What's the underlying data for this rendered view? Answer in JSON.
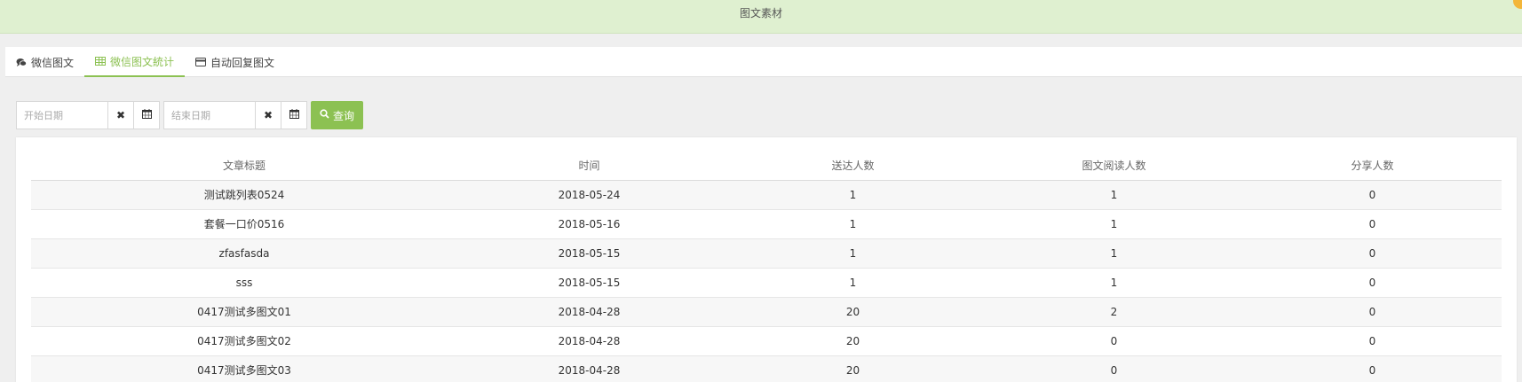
{
  "header": {
    "title": "图文素材"
  },
  "tabs": [
    {
      "label": "微信图文",
      "icon": "comments-icon",
      "active": false
    },
    {
      "label": "微信图文統计",
      "icon": "table-icon",
      "active": true
    },
    {
      "label": "自动回复图文",
      "icon": "card-icon",
      "active": false
    }
  ],
  "filter": {
    "start_placeholder": "开始日期",
    "end_placeholder": "结束日期",
    "clear_glyph": "✖",
    "calendar_glyph": "▦",
    "query_label": "查询"
  },
  "table": {
    "columns": [
      "文章标题",
      "时间",
      "送达人数",
      "图文阅读人数",
      "分享人数"
    ],
    "rows": [
      [
        "测试跳列表0524",
        "2018-05-24",
        "1",
        "1",
        "0"
      ],
      [
        "套餐一口价0516",
        "2018-05-16",
        "1",
        "1",
        "0"
      ],
      [
        "zfasfasda",
        "2018-05-15",
        "1",
        "1",
        "0"
      ],
      [
        "sss",
        "2018-05-15",
        "1",
        "1",
        "0"
      ],
      [
        "0417测试多图文01",
        "2018-04-28",
        "20",
        "2",
        "0"
      ],
      [
        "0417测试多图文02",
        "2018-04-28",
        "20",
        "0",
        "0"
      ],
      [
        "0417测试多图文03",
        "2018-04-28",
        "20",
        "0",
        "0"
      ]
    ]
  },
  "colors": {
    "accent": "#8cc152",
    "header_bg": "#dff0d0",
    "page_bg": "#efefef"
  }
}
